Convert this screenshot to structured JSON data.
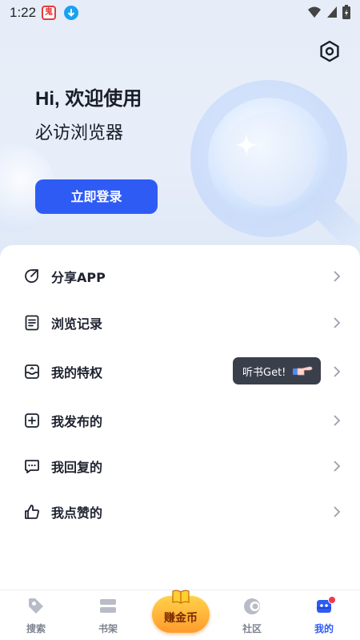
{
  "status_bar": {
    "time": "1:22"
  },
  "hero": {
    "greeting": "Hi, 欢迎使用",
    "app_name": "必访浏览器",
    "login_label": "立即登录"
  },
  "menu": {
    "items": [
      {
        "label": "分享APP",
        "icon": "share-icon"
      },
      {
        "label": "浏览记录",
        "icon": "history-icon"
      },
      {
        "label": "我的特权",
        "icon": "privilege-icon"
      },
      {
        "label": "我发布的",
        "icon": "post-icon"
      },
      {
        "label": "我回复的",
        "icon": "reply-icon"
      },
      {
        "label": "我点赞的",
        "icon": "like-icon"
      }
    ],
    "tooltip": "听书Get!"
  },
  "tabbar": {
    "tabs": [
      {
        "label": "搜索",
        "icon": "search-tag-icon"
      },
      {
        "label": "书架",
        "icon": "bookshelf-icon"
      },
      {
        "label": "社区",
        "icon": "community-icon"
      },
      {
        "label": "我的",
        "icon": "profile-icon"
      }
    ],
    "earn_label": "赚金币",
    "active_color": "#2f5bf5"
  },
  "colors": {
    "accent": "#2f5bf5",
    "badge": "#f03a4a"
  }
}
